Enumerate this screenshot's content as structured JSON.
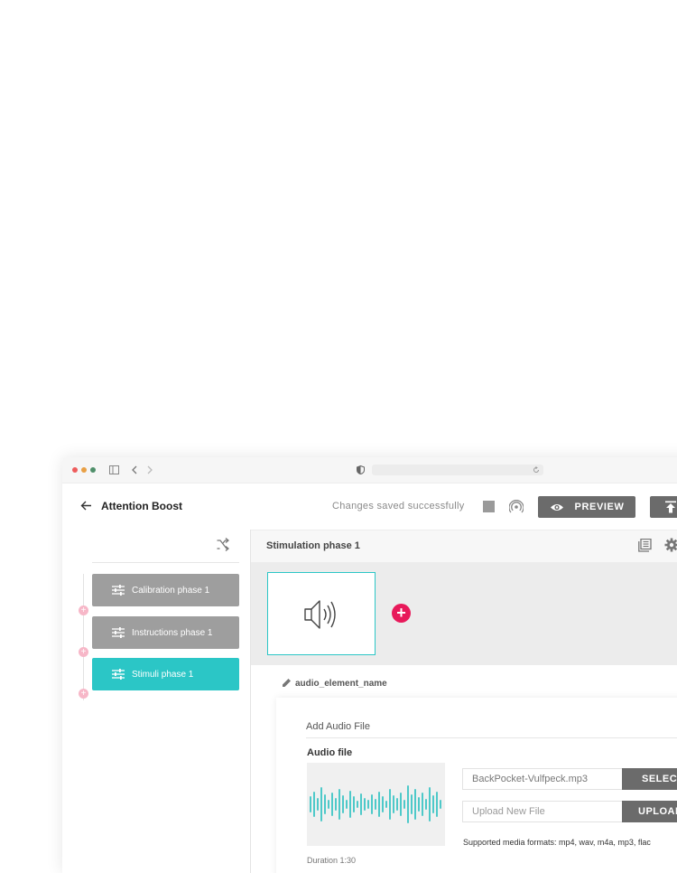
{
  "header": {
    "back_icon": "arrow-left-icon",
    "title": "Attention Boost",
    "status": "Changes saved successfully",
    "preview_label": "PREVIEW"
  },
  "sidebar": {
    "shuffle_icon": "shuffle-icon",
    "items": [
      {
        "label": "Calibration phase 1",
        "active": false
      },
      {
        "label": "Instructions phase 1",
        "active": false
      },
      {
        "label": "Stimuli phase 1",
        "active": true
      }
    ]
  },
  "main": {
    "title": "Stimulation phase 1",
    "element_name": "audio_element_name",
    "add_audio_label": "Add Audio File",
    "audio_file_label": "Audio file",
    "file_value": "BackPocket-Vulfpeck.mp3",
    "select_label": "SELECT",
    "upload_placeholder": "Upload New File",
    "upload_label": "UPLOAD",
    "formats": "Supported media formats: mp4, wav, m4a, mp3, flac",
    "duration": "Duration 1:30"
  },
  "colors": {
    "accent": "#2bc6c6",
    "add": "#e8195a",
    "button": "#6b6b6b",
    "inactive_phase": "#9e9e9e"
  }
}
